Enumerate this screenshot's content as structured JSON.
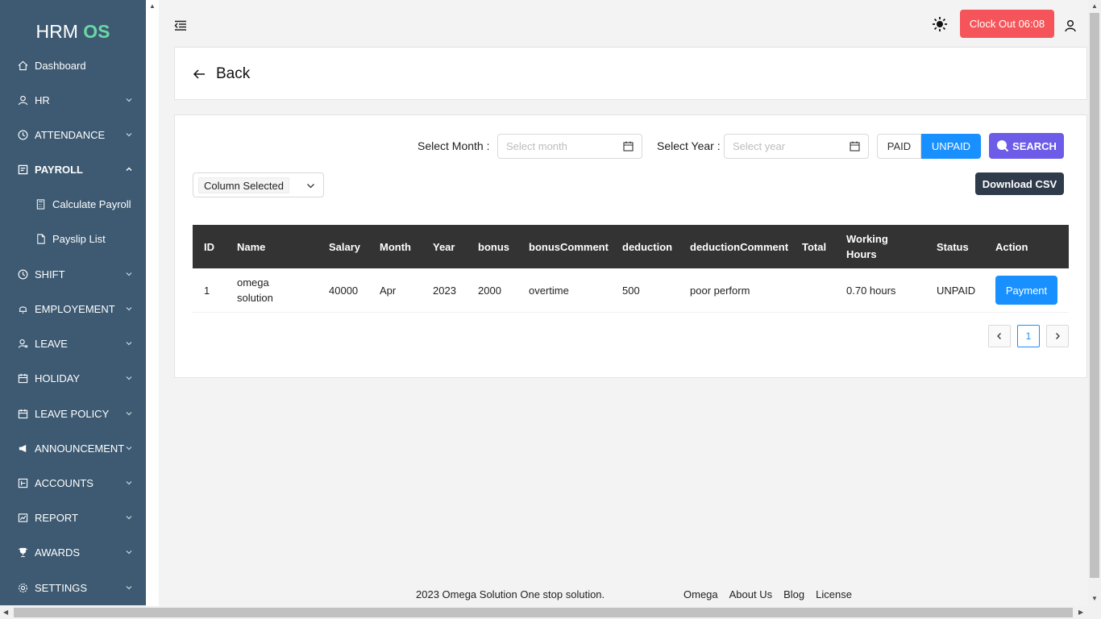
{
  "brand": {
    "part1": "HRM",
    "part2": "OS",
    "accent": "#6bd6a6"
  },
  "sidebar": {
    "items": [
      {
        "label": "Dashboard",
        "icon": "home-icon"
      },
      {
        "label": "HR",
        "icon": "user-icon"
      },
      {
        "label": "ATTENDANCE",
        "icon": "clock-icon"
      },
      {
        "label": "PAYROLL",
        "icon": "file-icon"
      },
      {
        "label": "Calculate Payroll",
        "icon": "calculator-icon"
      },
      {
        "label": "Payslip List",
        "icon": "document-icon"
      },
      {
        "label": "SHIFT",
        "icon": "clock-icon"
      },
      {
        "label": "EMPLOYEMENT",
        "icon": "bell-icon"
      },
      {
        "label": "LEAVE",
        "icon": "user-leave-icon"
      },
      {
        "label": "HOLIDAY",
        "icon": "calendar-icon"
      },
      {
        "label": "LEAVE POLICY",
        "icon": "calendar-icon"
      },
      {
        "label": "ANNOUNCEMENT",
        "icon": "megaphone-icon"
      },
      {
        "label": "ACCOUNTS",
        "icon": "account-book-icon"
      },
      {
        "label": "REPORT",
        "icon": "fund-icon"
      },
      {
        "label": "AWARDS",
        "icon": "trophy-icon"
      },
      {
        "label": "SETTINGS",
        "icon": "gear-icon"
      }
    ]
  },
  "header": {
    "clock_out_label": "Clock Out 06:08",
    "clock_color": "#f5555a"
  },
  "back": {
    "label": "Back"
  },
  "filters": {
    "month_label": "Select Month :",
    "month_placeholder": "Select month",
    "year_label": "Select Year :",
    "year_placeholder": "Select year",
    "paid_label": "PAID",
    "unpaid_label": "UNPAID",
    "selected_status": "UNPAID",
    "search_label": "SEARCH",
    "column_select_label": "Column Selected",
    "download_csv_label": "Download CSV"
  },
  "table": {
    "headers": [
      "ID",
      "Name",
      "Salary",
      "Month",
      "Year",
      "bonus",
      "bonusComment",
      "deduction",
      "deductionComment",
      "Total",
      "Working Hours",
      "Status",
      "Action"
    ],
    "rows": [
      {
        "id": "1",
        "name": "omega solution",
        "salary": "40000",
        "month": "Apr",
        "year": "2023",
        "bonus": "2000",
        "bonusComment": "overtime",
        "deduction": "500",
        "deductionComment": "poor perform",
        "total": "",
        "workingHours": "0.70 hours",
        "status": "UNPAID",
        "action": "Payment"
      }
    ]
  },
  "pagination": {
    "current": "1"
  },
  "footer": {
    "copyright": "2023 Omega Solution One stop solution.",
    "links": [
      "Omega",
      "About Us",
      "Blog",
      "License"
    ]
  }
}
